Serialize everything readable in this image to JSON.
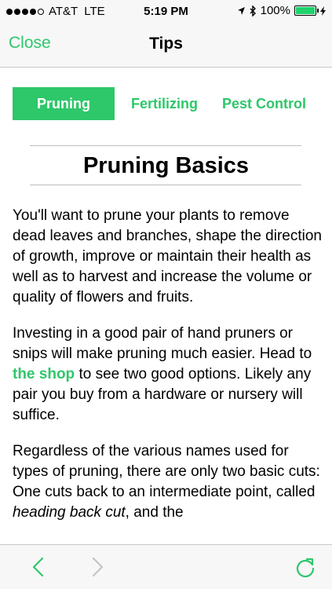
{
  "status": {
    "carrier": "AT&T",
    "network": "LTE",
    "time": "5:19 PM",
    "battery_text": "100%",
    "battery_level": 1.0
  },
  "nav": {
    "close_label": "Close",
    "title": "Tips"
  },
  "tabs": [
    {
      "label": "Pruning",
      "active": true
    },
    {
      "label": "Fertilizing",
      "active": false
    },
    {
      "label": "Pest Control",
      "active": false
    }
  ],
  "article": {
    "heading": "Pruning Basics",
    "p1": "You'll want to prune your plants to remove dead leaves and branches, shape the direction of growth, improve or maintain their health as well as to harvest and increase the volume or quality of flowers and fruits.",
    "p2_before": "Investing in a good pair of hand pruners or snips will make pruning much easier. Head to ",
    "p2_link": "the shop",
    "p2_after": " to see two good options. Likely any pair you buy from a hardware or nursery will suffice.",
    "p3_before": "Regardless of the various names used for types of pruning, there are only two basic cuts: One cuts back to an intermediate point, called ",
    "p3_em": "heading back cut",
    "p3_after": ", and the"
  },
  "colors": {
    "accent": "#2ec76a",
    "bar_background": "#f7f7f7"
  },
  "icons": {
    "back": "chevron-left-icon",
    "forward": "chevron-right-icon",
    "reload": "reload-icon"
  }
}
